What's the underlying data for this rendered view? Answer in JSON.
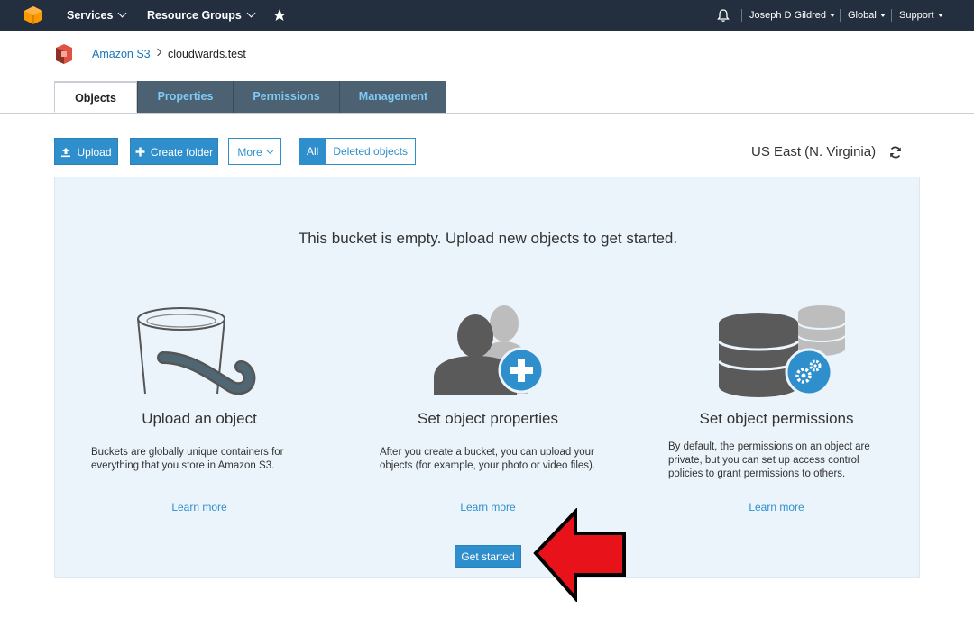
{
  "topnav": {
    "services": "Services",
    "resource_groups": "Resource Groups",
    "user": "Joseph D Gildred",
    "region": "Global",
    "support": "Support"
  },
  "breadcrumb": {
    "root": "Amazon S3",
    "current": "cloudwards.test"
  },
  "tabs": [
    {
      "label": "Objects",
      "active": true
    },
    {
      "label": "Properties",
      "active": false
    },
    {
      "label": "Permissions",
      "active": false
    },
    {
      "label": "Management",
      "active": false
    }
  ],
  "toolbar": {
    "upload": "Upload",
    "create_folder": "Create folder",
    "more": "More",
    "filter_all": "All",
    "filter_deleted": "Deleted objects",
    "region_label": "US East (N. Virginia)"
  },
  "empty_state": {
    "message": "This bucket is empty. Upload new objects to get started.",
    "columns": [
      {
        "title": "Upload an object",
        "description": "Buckets are globally unique containers for everything that you store in Amazon S3.",
        "link": "Learn more"
      },
      {
        "title": "Set object properties",
        "description": "After you create a bucket, you can upload your objects (for example, your photo or video files).",
        "link": "Learn more"
      },
      {
        "title": "Set object permissions",
        "description": "By default, the permissions on an object are private, but you can set up access control policies to grant permissions to others.",
        "link": "Learn more"
      }
    ],
    "cta": "Get started"
  },
  "colors": {
    "nav_bg": "#232f3e",
    "accent": "#2f8fcc",
    "tab_inactive_bg": "#4c6171",
    "panel_bg": "#ebf4fb",
    "arrow": "#e8121a"
  }
}
